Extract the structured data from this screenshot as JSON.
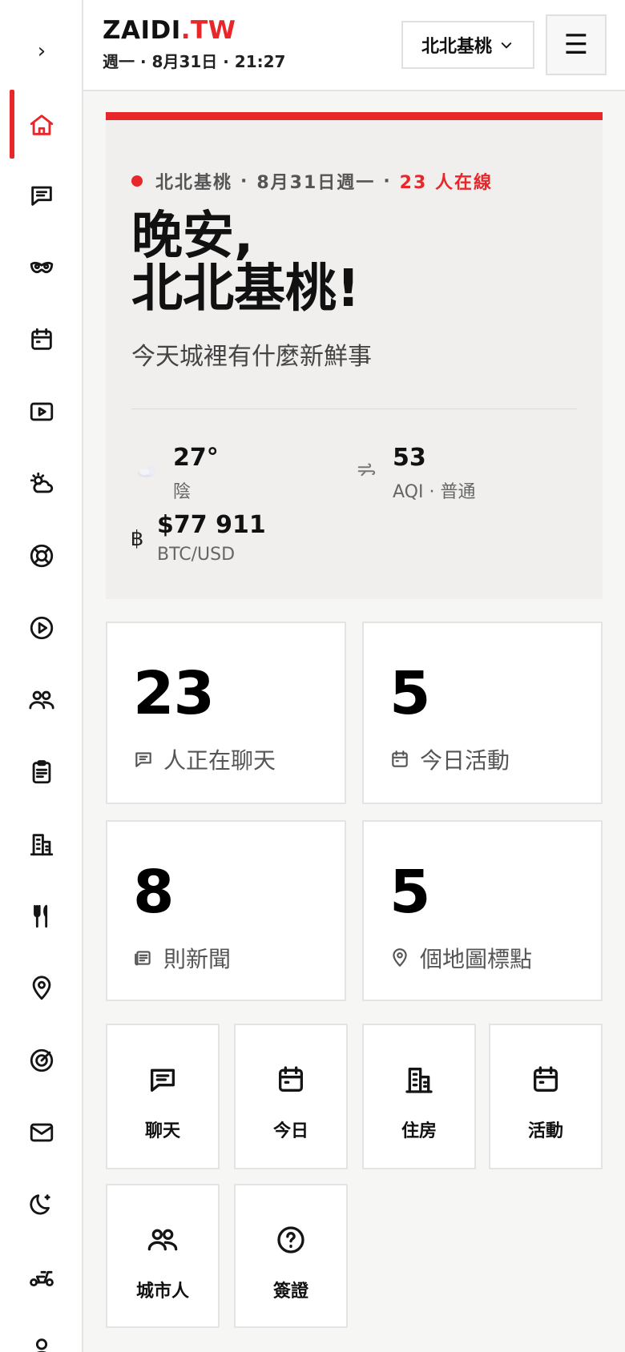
{
  "header": {
    "logo_main": "ZAIDI",
    "logo_tld": ".TW",
    "date_line": "週一 · 8月31日 · 21:27",
    "city_select": "北北基桃",
    "menu_icon": "hamburger-icon"
  },
  "rail": {
    "toggle_icon": "chevron-right-icon",
    "items": [
      {
        "icon": "home-icon",
        "active": true
      },
      {
        "icon": "chat-icon"
      },
      {
        "icon": "mask-icon"
      },
      {
        "icon": "calendar-icon"
      },
      {
        "icon": "video-icon"
      },
      {
        "icon": "weather-icon"
      },
      {
        "icon": "lifebuoy-icon"
      },
      {
        "icon": "play-circle-icon"
      },
      {
        "icon": "people-icon"
      },
      {
        "icon": "clipboard-icon"
      },
      {
        "icon": "building-icon"
      },
      {
        "icon": "restaurant-icon"
      },
      {
        "icon": "map-pin-icon"
      },
      {
        "icon": "target-icon"
      },
      {
        "icon": "mail-icon"
      },
      {
        "icon": "moon-icon"
      },
      {
        "icon": "scooter-icon"
      },
      {
        "icon": "user-icon"
      }
    ],
    "accent_color": "#e8272a"
  },
  "hero": {
    "city": "北北基桃",
    "date": "8月31日週一",
    "online": "23 人在線",
    "title_line1": "晚安,",
    "title_line2": "北北基桃!",
    "subtitle": "今天城裡有什麼新鮮事",
    "weather_value": "27°",
    "weather_label": "陰",
    "aqi_value": "53",
    "aqi_label": "AQI · 普通",
    "btc_value": "$77 911",
    "btc_label": "BTC/USD"
  },
  "metrics": [
    {
      "value": "23",
      "label": "人正在聊天",
      "icon": "chat-icon"
    },
    {
      "value": "5",
      "label": "今日活動",
      "icon": "calendar-icon"
    },
    {
      "value": "8",
      "label": "則新聞",
      "icon": "newspaper-icon"
    },
    {
      "value": "5",
      "label": "個地圖標點",
      "icon": "map-pin-icon"
    }
  ],
  "shortcuts": [
    {
      "label": "聊天",
      "icon": "chat-icon"
    },
    {
      "label": "今日",
      "icon": "calendar-icon"
    },
    {
      "label": "住房",
      "icon": "building-icon"
    },
    {
      "label": "活動",
      "icon": "calendar-icon"
    },
    {
      "label": "城市人",
      "icon": "people-icon"
    },
    {
      "label": "簽證",
      "icon": "question-icon"
    }
  ]
}
